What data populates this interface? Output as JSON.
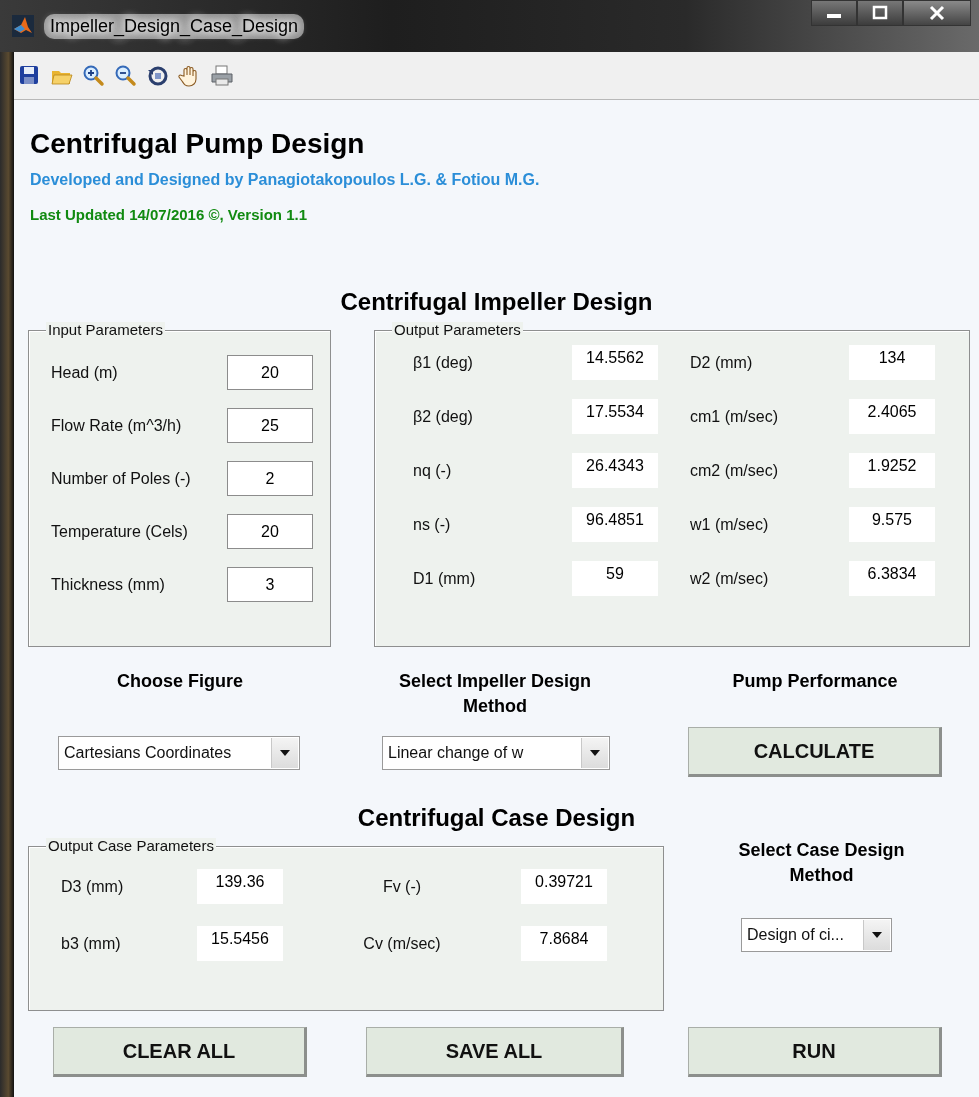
{
  "window": {
    "title": "Impeller_Design_Case_Design"
  },
  "header": {
    "title": "Centrifugal Pump Design",
    "credits": "Developed and Designed by Panagiotakopoulos L.G. & Fotiou M.G.",
    "updated": "Last Updated 14/07/2016 ©, Version 1.1"
  },
  "impeller_section": {
    "title": "Centrifugal Impeller Design"
  },
  "input_parameters": {
    "title": "Input Parameters",
    "fields": [
      {
        "label": "Head (m)",
        "value": "20"
      },
      {
        "label": "Flow Rate (m^3/h)",
        "value": "25"
      },
      {
        "label": "Number of Poles (-)",
        "value": "2"
      },
      {
        "label": "Temperature (Cels)",
        "value": "20"
      },
      {
        "label": "Thickness (mm)",
        "value": "3"
      }
    ]
  },
  "output_parameters": {
    "title": "Output Parameters",
    "fields": [
      {
        "label": "β1 (deg)",
        "value": "14.5562"
      },
      {
        "label": "D2 (mm)",
        "value": "134"
      },
      {
        "label": "β2 (deg)",
        "value": "17.5534"
      },
      {
        "label": "cm1 (m/sec)",
        "value": "2.4065"
      },
      {
        "label": "nq (-)",
        "value": "26.4343"
      },
      {
        "label": "cm2 (m/sec)",
        "value": "1.9252"
      },
      {
        "label": "ns (-)",
        "value": "96.4851"
      },
      {
        "label": "w1 (m/sec)",
        "value": "9.575"
      },
      {
        "label": "D1 (mm)",
        "value": "59"
      },
      {
        "label": "w2 (m/sec)",
        "value": "6.3834"
      }
    ]
  },
  "controls": [
    {
      "kind": "select",
      "label": "Choose Figure",
      "value": "Cartesians Coordinates"
    },
    {
      "kind": "select",
      "label": "Select Impeller  Design Method",
      "value": "Linear change of w"
    },
    {
      "kind": "button",
      "label": "Pump Performance",
      "value": "CALCULATE"
    }
  ],
  "case_section": {
    "title": "Centrifugal Case Design"
  },
  "output_case_parameters": {
    "title": "Output Case Parameters",
    "fields": [
      {
        "label": "D3 (mm)",
        "value": "139.36"
      },
      {
        "label": "Fv (-)",
        "value": "0.39721"
      },
      {
        "label": "b3 (mm)",
        "value": "15.5456"
      },
      {
        "label": "Cv (m/sec)",
        "value": "7.8684"
      }
    ]
  },
  "case_method": {
    "label": "Select Case Design Method",
    "value": "Design of ci..."
  },
  "buttons": [
    "CLEAR ALL",
    "SAVE ALL",
    "RUN"
  ]
}
